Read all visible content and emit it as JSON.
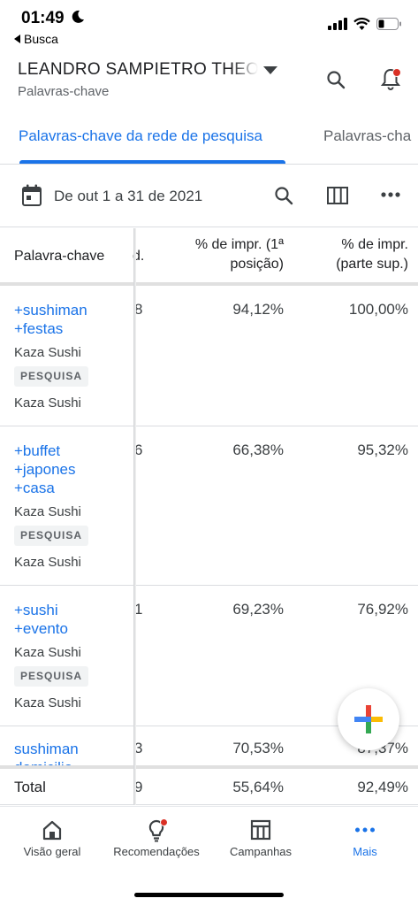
{
  "status_bar": {
    "time": "01:49",
    "back_label": "Busca"
  },
  "account": {
    "name": "LEANDRO SAMPIETRO THEO",
    "page": "Palavras-chave"
  },
  "tabs": [
    {
      "label": "Palavras-chave da rede de pesquisa",
      "active": true
    },
    {
      "label": "Palavras-cha",
      "active": false
    }
  ],
  "date_range": "De out 1 a 31 de 2021",
  "table": {
    "headers": {
      "keyword": "Palavra-chave",
      "partial": "d.",
      "abs_top": "% de impr. (1ª\nposição)",
      "top": "% de impr.\n(parte sup.)"
    },
    "rows": [
      {
        "keyword": "+sushiman\n+festas",
        "campaign": "Kaza Sushi",
        "badge": "PESQUISA",
        "ad_group": "Kaza Sushi",
        "partial": "8",
        "abs_top": "94,12%",
        "top": "100,00%"
      },
      {
        "keyword": "+buffet\n+japones\n+casa",
        "campaign": "Kaza Sushi",
        "badge": "PESQUISA",
        "ad_group": "Kaza Sushi",
        "partial": "6",
        "abs_top": "66,38%",
        "top": "95,32%"
      },
      {
        "keyword": "+sushi\n+evento",
        "campaign": "Kaza Sushi",
        "badge": "PESQUISA",
        "ad_group": "Kaza Sushi",
        "partial": "1",
        "abs_top": "69,23%",
        "top": "76,92%"
      },
      {
        "keyword": "sushiman\ndomicilio",
        "partial": "3",
        "abs_top": "70,53%",
        "top": "87,37%"
      }
    ],
    "total": {
      "label": "Total",
      "partial": "9",
      "abs_top": "55,64%",
      "top": "92,49%"
    }
  },
  "bottom_nav": [
    {
      "label": "Visão geral",
      "icon": "home-icon",
      "active": false
    },
    {
      "label": "Recomendações",
      "icon": "lightbulb-icon",
      "active": false
    },
    {
      "label": "Campanhas",
      "icon": "campaigns-icon",
      "active": false
    },
    {
      "label": "Mais",
      "icon": "more-dots-icon",
      "active": true
    }
  ],
  "colors": {
    "accent": "#1a73e8",
    "notification": "#d93025",
    "google_red": "#ea4335",
    "google_blue": "#4285f4",
    "google_yellow": "#fbbc04",
    "google_green": "#34a853"
  }
}
